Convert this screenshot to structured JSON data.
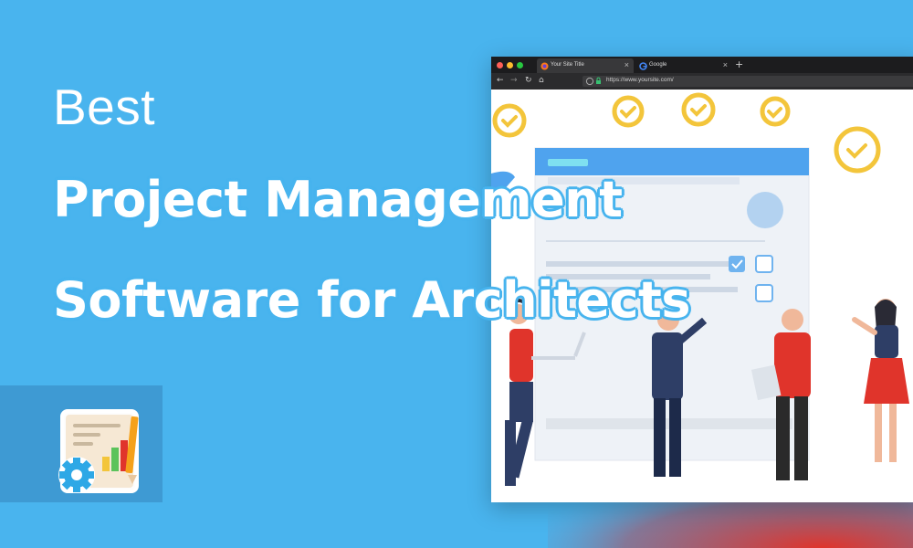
{
  "heading": {
    "best": "Best",
    "line1": "Project Management",
    "line2": "Software for Architects"
  },
  "browser": {
    "tabs": [
      {
        "label": "Your Site Title",
        "icon": "firefox-icon"
      },
      {
        "label": "Google",
        "icon": "google-icon"
      }
    ],
    "url": "https://www.yoursite.com/"
  },
  "colors": {
    "background": "#49b4ee",
    "tile": "#3e9ad3",
    "accent_red": "#e0342b",
    "check_yellow": "#f3c53b"
  }
}
